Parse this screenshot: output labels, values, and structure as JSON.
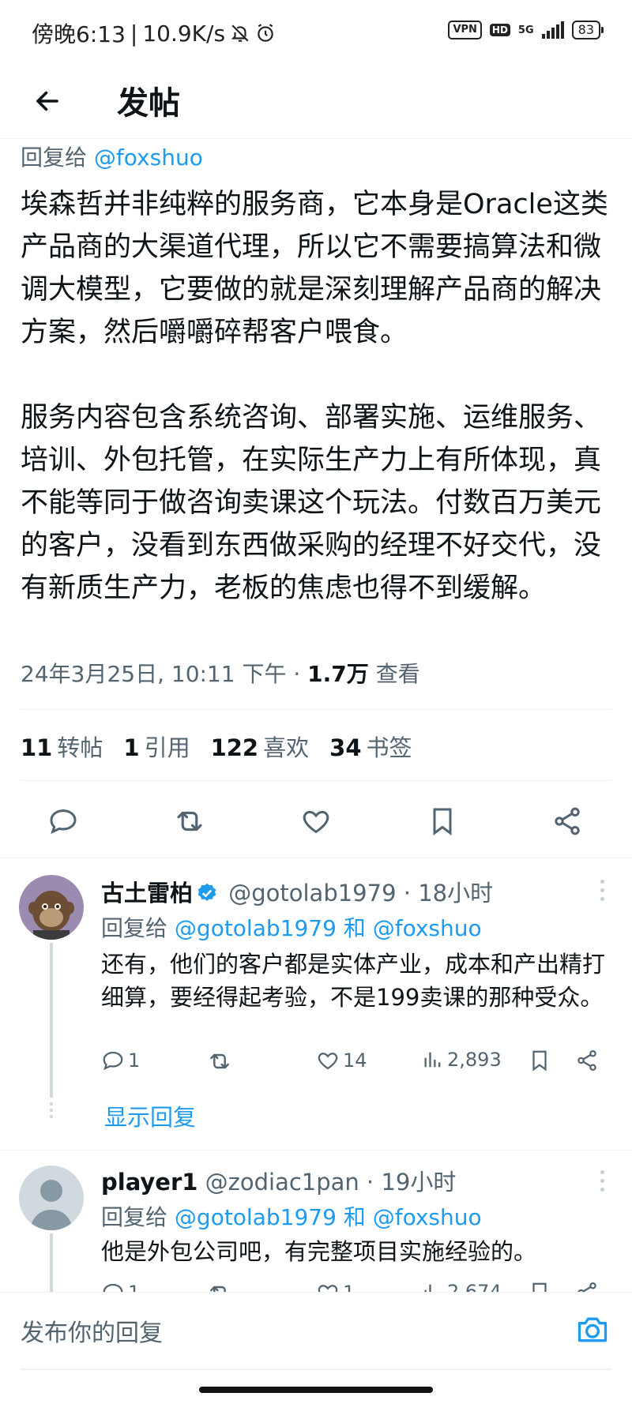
{
  "status_bar": {
    "time": "傍晚6:13",
    "speed": "10.9K/s",
    "vpn": "VPN",
    "hd": "HD",
    "network": "5G",
    "battery": "83"
  },
  "header": {
    "title": "发帖",
    "back_icon": "arrow-left-icon"
  },
  "tweet": {
    "reply_prefix": "回复给",
    "reply_handle": "@foxshuo",
    "paragraphs": [
      "埃森哲并非纯粹的服务商，它本身是Oracle这类产品商的大渠道代理，所以它不需要搞算法和微调大模型，它要做的就是深刻理解产品商的解决方案，然后嚼嚼碎帮客户喂食。",
      "服务内容包含系统咨询、部署实施、运维服务、培训、外包托管，在实际生产力上有所体现，真不能等同于做咨询卖课这个玩法。付数百万美元的客户，没看到东西做采购的经理不好交代，没有新质生产力，老板的焦虑也得不到缓解。"
    ],
    "timestamp": "24年3月25日, 10:11 下午 · ",
    "views_count": "1.7万",
    "views_label": "查看",
    "stats": {
      "retweets_count": "11",
      "retweets_label": "转帖",
      "quotes_count": "1",
      "quotes_label": "引用",
      "likes_count": "122",
      "likes_label": "喜欢",
      "bookmarks_count": "34",
      "bookmarks_label": "书签"
    },
    "actions": [
      "reply-icon",
      "retweet-icon",
      "like-icon",
      "bookmark-icon",
      "share-icon"
    ]
  },
  "replies": [
    {
      "name": "古土雷柏",
      "verified": true,
      "handle": "@gotolab1979",
      "time": "· 18小时",
      "reply_prefix": "回复给",
      "reply_handle_1": "@gotolab1979",
      "reply_and": "和",
      "reply_handle_2": "@foxshuo",
      "text": "还有，他们的客户都是实体产业，成本和产出精打细算，要经得起考验，不是199卖课的那种受众。",
      "reply_count": "1",
      "retweet_count": "",
      "like_count": "14",
      "view_count": "2,893",
      "show_replies": "显示回复"
    },
    {
      "name": "player1",
      "verified": false,
      "handle": "@zodiac1pan",
      "time": "· 19小时",
      "reply_prefix": "回复给",
      "reply_handle_1": "@gotolab1979",
      "reply_and": "和",
      "reply_handle_2": "@foxshuo",
      "text": "他是外包公司吧，有完整项目实施经验的。",
      "reply_count": "1",
      "retweet_count": "",
      "like_count": "1",
      "view_count": "2,674"
    }
  ],
  "compose": {
    "placeholder": "发布你的回复",
    "camera_icon": "camera-icon"
  },
  "colors": {
    "accent": "#1d9bf0",
    "text": "#0f1419",
    "secondary": "#536471",
    "divider": "#eff3f4"
  }
}
